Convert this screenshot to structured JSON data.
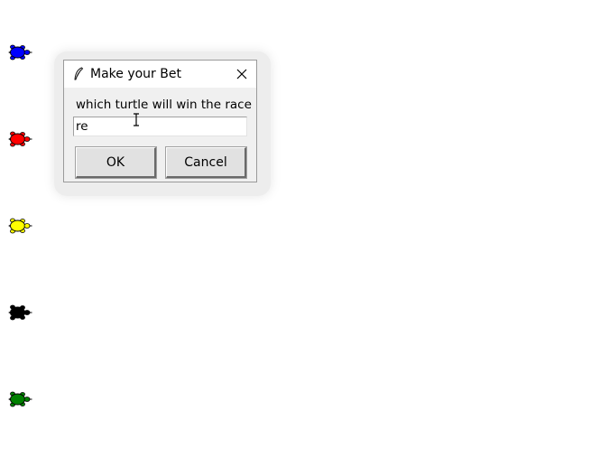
{
  "turtles": [
    {
      "color": "#0000ff",
      "name": "blue"
    },
    {
      "color": "#ff0000",
      "name": "red"
    },
    {
      "color": "#ffff00",
      "name": "yellow"
    },
    {
      "color": "#000000",
      "name": "black"
    },
    {
      "color": "#008000",
      "name": "green"
    }
  ],
  "dialog": {
    "title": "Make your Bet",
    "title_icon": "feather-icon",
    "close_icon": "close-icon",
    "prompt": "which turtle will win the race",
    "input_value": "re",
    "ok_label": "OK",
    "cancel_label": "Cancel"
  }
}
